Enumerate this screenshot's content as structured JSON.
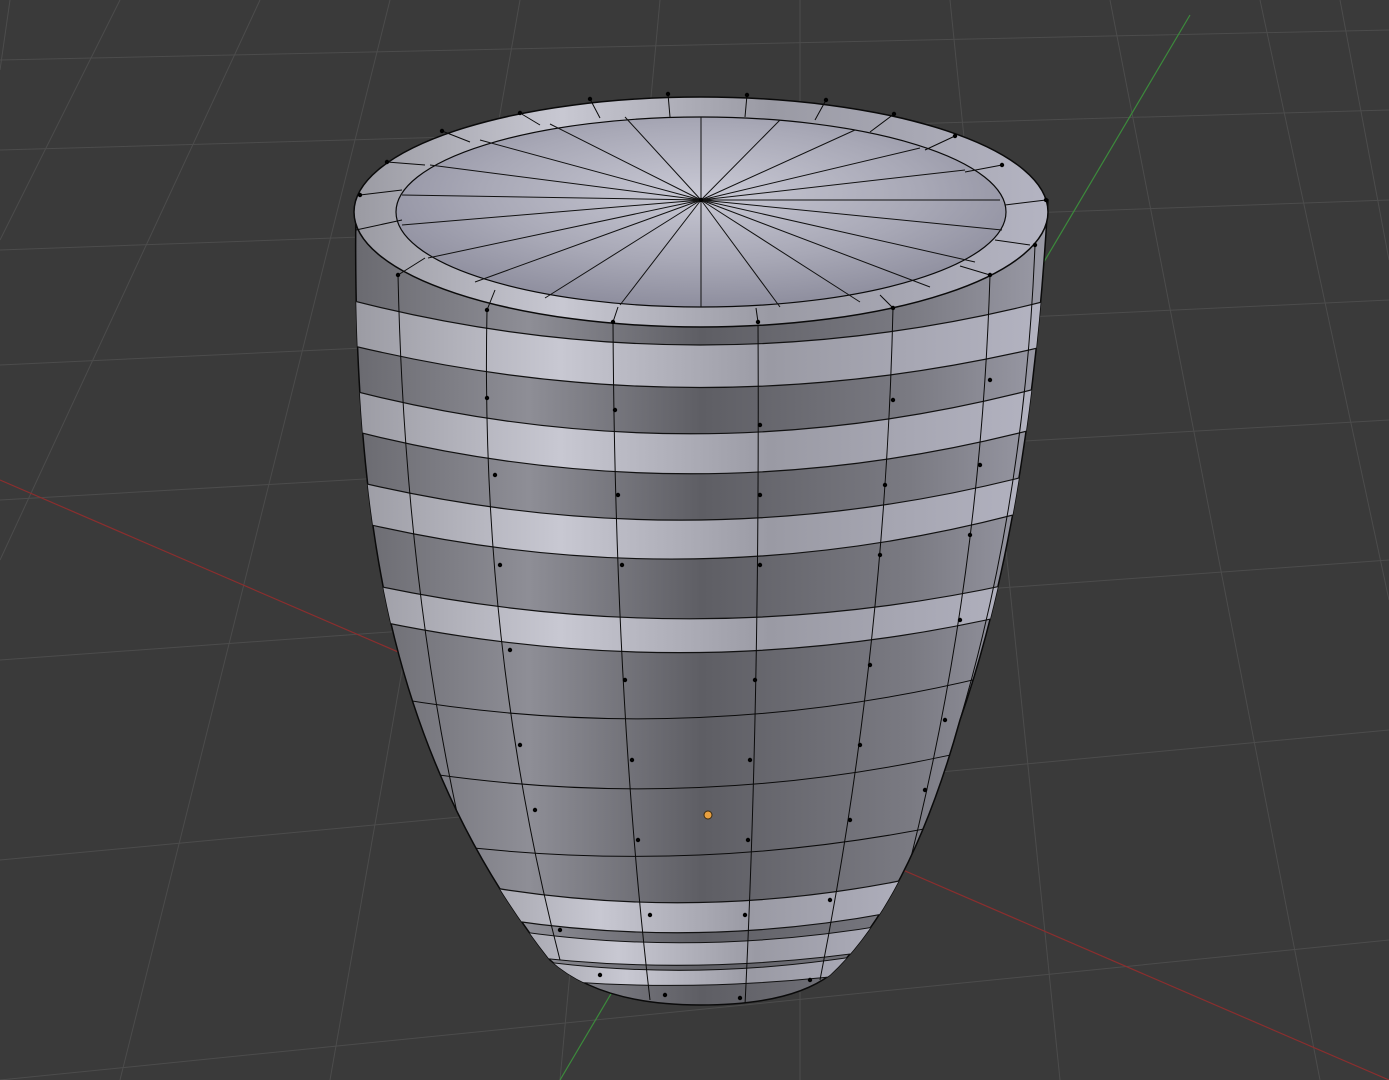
{
  "viewport": {
    "background": "#3a3a3a",
    "grid_color": "#4a4a4a",
    "x_axis_color": "#8b2e2e",
    "y_axis_color": "#3c8a3c",
    "mesh_face_color": "#8a8a92",
    "mesh_edge_color": "#0a0a0a",
    "origin_color": "#e8a040"
  },
  "scene": {
    "object": "barrel-mesh",
    "shading": "solid",
    "edit_mode": true
  }
}
